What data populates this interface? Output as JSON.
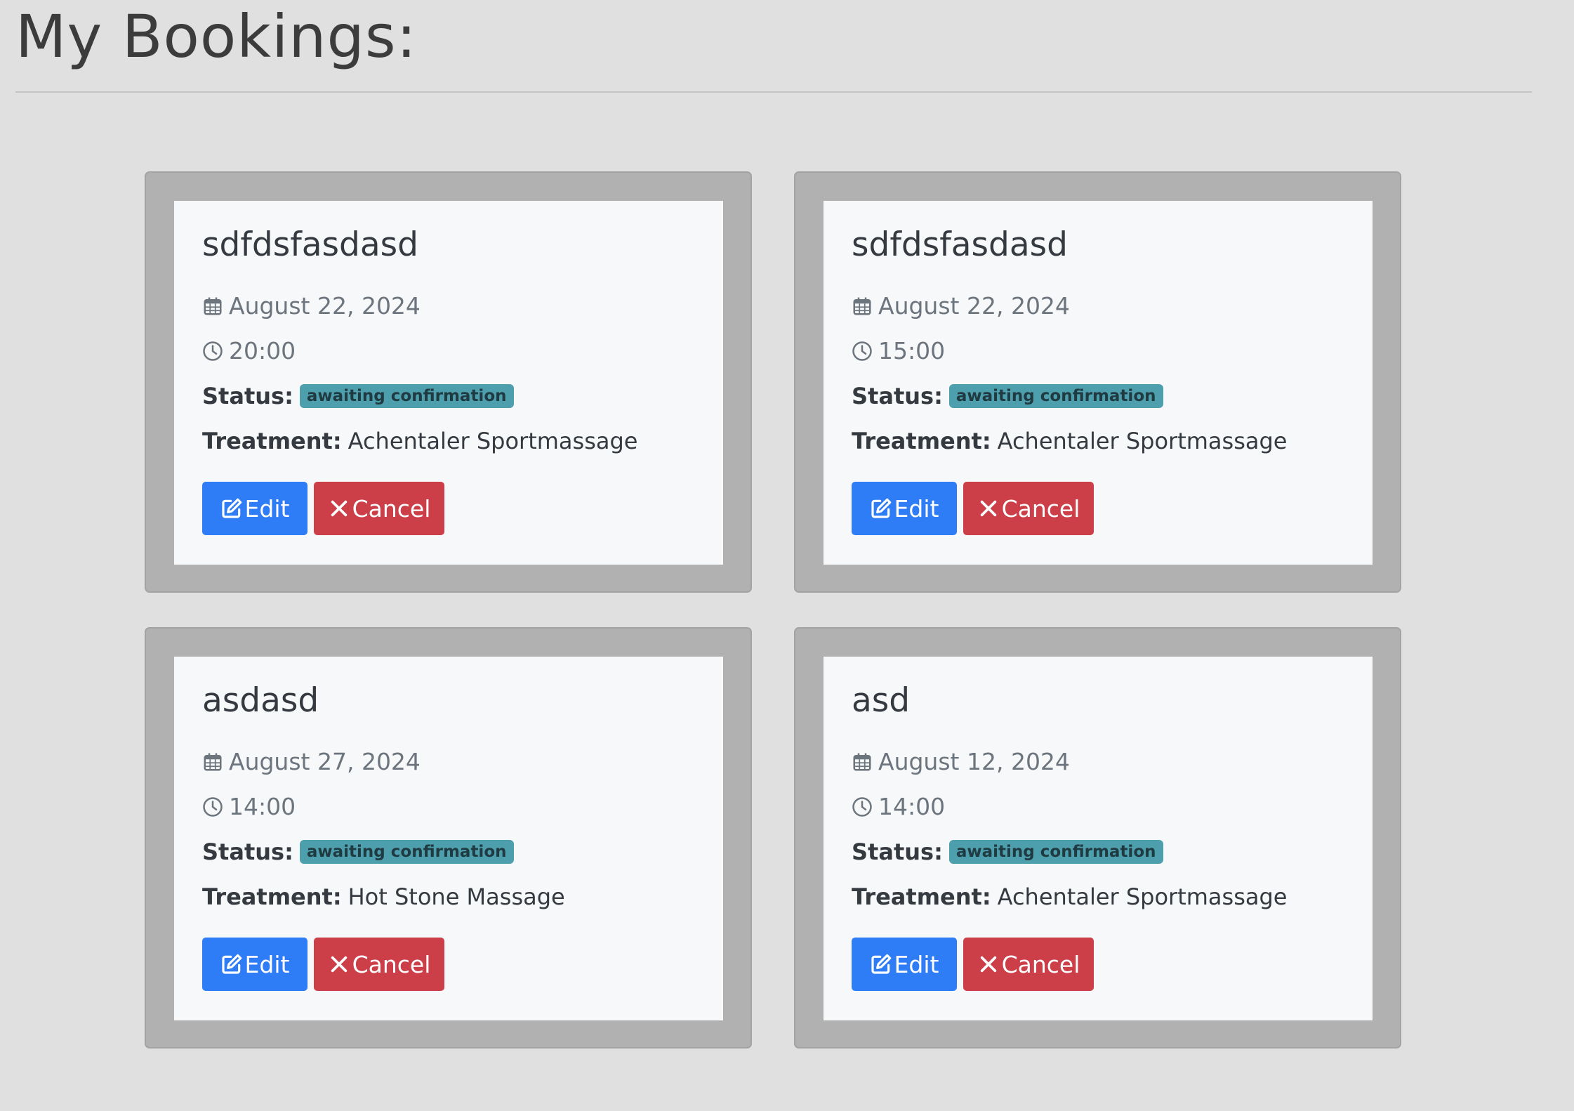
{
  "page": {
    "title": "My Bookings:"
  },
  "labels": {
    "status": "Status:",
    "treatment": "Treatment:",
    "edit": "Edit",
    "cancel": "Cancel"
  },
  "icons": {
    "date": "calendar-icon",
    "time": "clock-icon",
    "edit": "edit-icon",
    "cancel": "close-icon"
  },
  "colors": {
    "page_background": "#e0e0e0",
    "card_frame": "#b1b1b1",
    "card_body": "#f7f8fa",
    "edit_button": "#2e7cf6",
    "cancel_button": "#cc3f48",
    "status_badge": "#4e9fae"
  },
  "bookings": [
    {
      "name": "sdfdsfasdasd",
      "date": "August 22, 2024",
      "time": "20:00",
      "status": "awaiting confirmation",
      "treatment": "Achentaler Sportmassage"
    },
    {
      "name": "sdfdsfasdasd",
      "date": "August 22, 2024",
      "time": "15:00",
      "status": "awaiting confirmation",
      "treatment": "Achentaler Sportmassage"
    },
    {
      "name": "asdasd",
      "date": "August 27, 2024",
      "time": "14:00",
      "status": "awaiting confirmation",
      "treatment": "Hot Stone Massage"
    },
    {
      "name": "asd",
      "date": "August 12, 2024",
      "time": "14:00",
      "status": "awaiting confirmation",
      "treatment": "Achentaler Sportmassage"
    }
  ]
}
